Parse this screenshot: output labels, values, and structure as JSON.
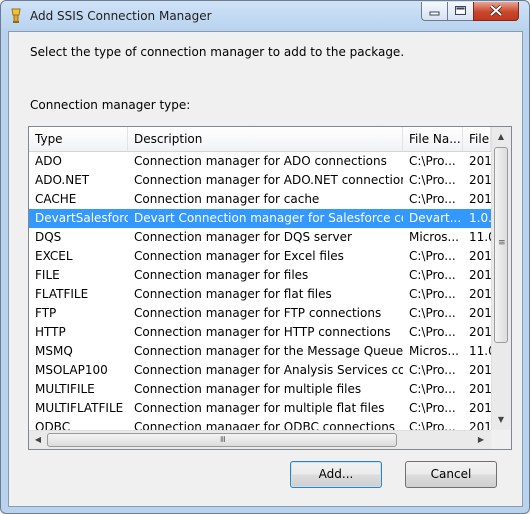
{
  "window": {
    "title": "Add SSIS Connection Manager"
  },
  "instruction": "Select the type of connection manager to add to the package.",
  "type_label": "Connection manager type:",
  "columns": [
    "Type",
    "Description",
    "File Na...",
    "File"
  ],
  "rows": [
    {
      "type": "ADO",
      "description": "Connection manager for ADO connections",
      "file_name": "C:\\Pro...",
      "file": "201"
    },
    {
      "type": "ADO.NET",
      "description": "Connection manager for ADO.NET connections",
      "file_name": "C:\\Pro...",
      "file": "201"
    },
    {
      "type": "CACHE",
      "description": "Connection manager for cache",
      "file_name": "C:\\Pro...",
      "file": "201"
    },
    {
      "type": "DevartSalesforce",
      "description": "Devart Connection manager for Salesforce conn...",
      "file_name": "Devart...",
      "file": "1.0."
    },
    {
      "type": "DQS",
      "description": "Connection manager for DQS server",
      "file_name": "Micros...",
      "file": "11.0"
    },
    {
      "type": "EXCEL",
      "description": "Connection manager for Excel files",
      "file_name": "C:\\Pro...",
      "file": "201"
    },
    {
      "type": "FILE",
      "description": "Connection manager for files",
      "file_name": "C:\\Pro...",
      "file": "201"
    },
    {
      "type": "FLATFILE",
      "description": "Connection manager for flat files",
      "file_name": "C:\\Pro...",
      "file": "201"
    },
    {
      "type": "FTP",
      "description": "Connection manager for FTP connections",
      "file_name": "C:\\Pro...",
      "file": "201"
    },
    {
      "type": "HTTP",
      "description": "Connection manager for HTTP connections",
      "file_name": "C:\\Pro...",
      "file": "201"
    },
    {
      "type": "MSMQ",
      "description": "Connection manager for the Message Queue task",
      "file_name": "Micros...",
      "file": "11.0"
    },
    {
      "type": "MSOLAP100",
      "description": "Connection manager for Analysis Services conn...",
      "file_name": "C:\\Pro...",
      "file": "201"
    },
    {
      "type": "MULTIFILE",
      "description": "Connection manager for multiple files",
      "file_name": "C:\\Pro...",
      "file": "201"
    },
    {
      "type": "MULTIFLATFILE",
      "description": "Connection manager for multiple flat files",
      "file_name": "C:\\Pro...",
      "file": "201"
    },
    {
      "type": "ODBC",
      "description": "Connection manager for ODBC connections",
      "file_name": "C:\\Pro...",
      "file": "201"
    }
  ],
  "selected_row": "DevartSalesforce",
  "buttons": {
    "add": "Add...",
    "cancel": "Cancel"
  },
  "colors": {
    "selection": "#3399ff",
    "close_button": "#c9462c"
  }
}
